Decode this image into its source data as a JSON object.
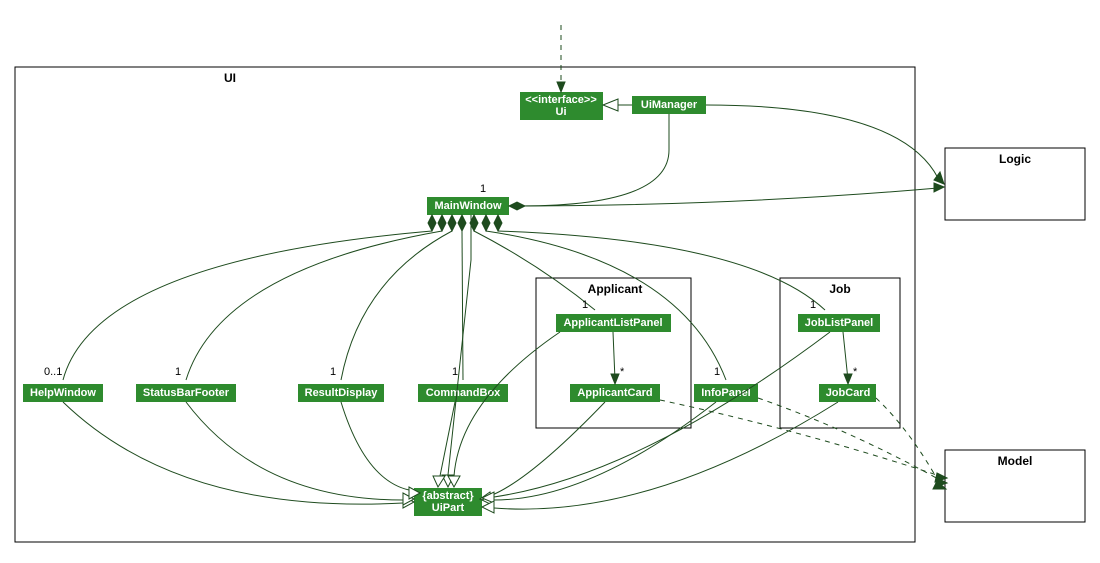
{
  "packages": {
    "ui": "UI",
    "applicant": "Applicant",
    "job": "Job",
    "logic": "Logic",
    "model": "Model"
  },
  "classes": {
    "ui_interface": {
      "stereotype": "<<interface>>",
      "name": "Ui"
    },
    "ui_manager": "UiManager",
    "main_window": "MainWindow",
    "help_window": "HelpWindow",
    "status_bar": "StatusBarFooter",
    "result_display": "ResultDisplay",
    "command_box": "CommandBox",
    "applicant_list": "ApplicantListPanel",
    "applicant_card": "ApplicantCard",
    "info_panel": "InfoPanel",
    "job_list": "JobListPanel",
    "job_card": "JobCard",
    "ui_part": {
      "stereotype": "{abstract}",
      "name": "UiPart"
    }
  },
  "multiplicities": {
    "mw": "1",
    "hw": "0..1",
    "sbf": "1",
    "rd": "1",
    "cb": "1",
    "alp": "1",
    "ip": "1",
    "jlp": "1",
    "ac": "*",
    "jc": "*"
  },
  "chart_data": {
    "type": "uml-class-diagram",
    "packages": [
      {
        "name": "UI",
        "contains": [
          "Ui",
          "UiManager",
          "MainWindow",
          "HelpWindow",
          "StatusBarFooter",
          "ResultDisplay",
          "CommandBox",
          "Applicant",
          "Job",
          "InfoPanel",
          "UiPart"
        ]
      },
      {
        "name": "Applicant",
        "contains": [
          "ApplicantListPanel",
          "ApplicantCard"
        ],
        "parent": "UI"
      },
      {
        "name": "Job",
        "contains": [
          "JobListPanel",
          "JobCard"
        ],
        "parent": "UI"
      },
      {
        "name": "Logic"
      },
      {
        "name": "Model"
      }
    ],
    "classes": [
      {
        "name": "Ui",
        "stereotype": "<<interface>>"
      },
      {
        "name": "UiManager"
      },
      {
        "name": "MainWindow"
      },
      {
        "name": "HelpWindow"
      },
      {
        "name": "StatusBarFooter"
      },
      {
        "name": "ResultDisplay"
      },
      {
        "name": "CommandBox"
      },
      {
        "name": "ApplicantListPanel"
      },
      {
        "name": "ApplicantCard"
      },
      {
        "name": "InfoPanel"
      },
      {
        "name": "JobListPanel"
      },
      {
        "name": "JobCard"
      },
      {
        "name": "UiPart",
        "stereotype": "{abstract}"
      }
    ],
    "relationships": [
      {
        "from": "(external)",
        "to": "Ui",
        "type": "dependency"
      },
      {
        "from": "UiManager",
        "to": "Ui",
        "type": "realization"
      },
      {
        "from": "UiManager",
        "to": "MainWindow",
        "type": "composition",
        "multiplicity": "1"
      },
      {
        "from": "UiManager",
        "to": "Logic",
        "type": "association-navigable"
      },
      {
        "from": "MainWindow",
        "to": "Logic",
        "type": "association-navigable"
      },
      {
        "from": "MainWindow",
        "to": "HelpWindow",
        "type": "composition",
        "multiplicity": "0..1"
      },
      {
        "from": "MainWindow",
        "to": "StatusBarFooter",
        "type": "composition",
        "multiplicity": "1"
      },
      {
        "from": "MainWindow",
        "to": "ResultDisplay",
        "type": "composition",
        "multiplicity": "1"
      },
      {
        "from": "MainWindow",
        "to": "CommandBox",
        "type": "composition",
        "multiplicity": "1"
      },
      {
        "from": "MainWindow",
        "to": "ApplicantListPanel",
        "type": "composition",
        "multiplicity": "1"
      },
      {
        "from": "MainWindow",
        "to": "InfoPanel",
        "type": "composition",
        "multiplicity": "1"
      },
      {
        "from": "MainWindow",
        "to": "JobListPanel",
        "type": "composition",
        "multiplicity": "1"
      },
      {
        "from": "ApplicantListPanel",
        "to": "ApplicantCard",
        "type": "association-navigable",
        "multiplicity": "*"
      },
      {
        "from": "JobListPanel",
        "to": "JobCard",
        "type": "association-navigable",
        "multiplicity": "*"
      },
      {
        "from": "MainWindow",
        "to": "UiPart",
        "type": "generalization"
      },
      {
        "from": "HelpWindow",
        "to": "UiPart",
        "type": "generalization"
      },
      {
        "from": "StatusBarFooter",
        "to": "UiPart",
        "type": "generalization"
      },
      {
        "from": "ResultDisplay",
        "to": "UiPart",
        "type": "generalization"
      },
      {
        "from": "CommandBox",
        "to": "UiPart",
        "type": "generalization"
      },
      {
        "from": "ApplicantListPanel",
        "to": "UiPart",
        "type": "generalization"
      },
      {
        "from": "ApplicantCard",
        "to": "UiPart",
        "type": "generalization"
      },
      {
        "from": "InfoPanel",
        "to": "UiPart",
        "type": "generalization"
      },
      {
        "from": "JobListPanel",
        "to": "UiPart",
        "type": "generalization"
      },
      {
        "from": "JobCard",
        "to": "UiPart",
        "type": "generalization"
      },
      {
        "from": "ApplicantCard",
        "to": "Model",
        "type": "dependency"
      },
      {
        "from": "InfoPanel",
        "to": "Model",
        "type": "dependency"
      },
      {
        "from": "JobCard",
        "to": "Model",
        "type": "dependency"
      }
    ]
  }
}
